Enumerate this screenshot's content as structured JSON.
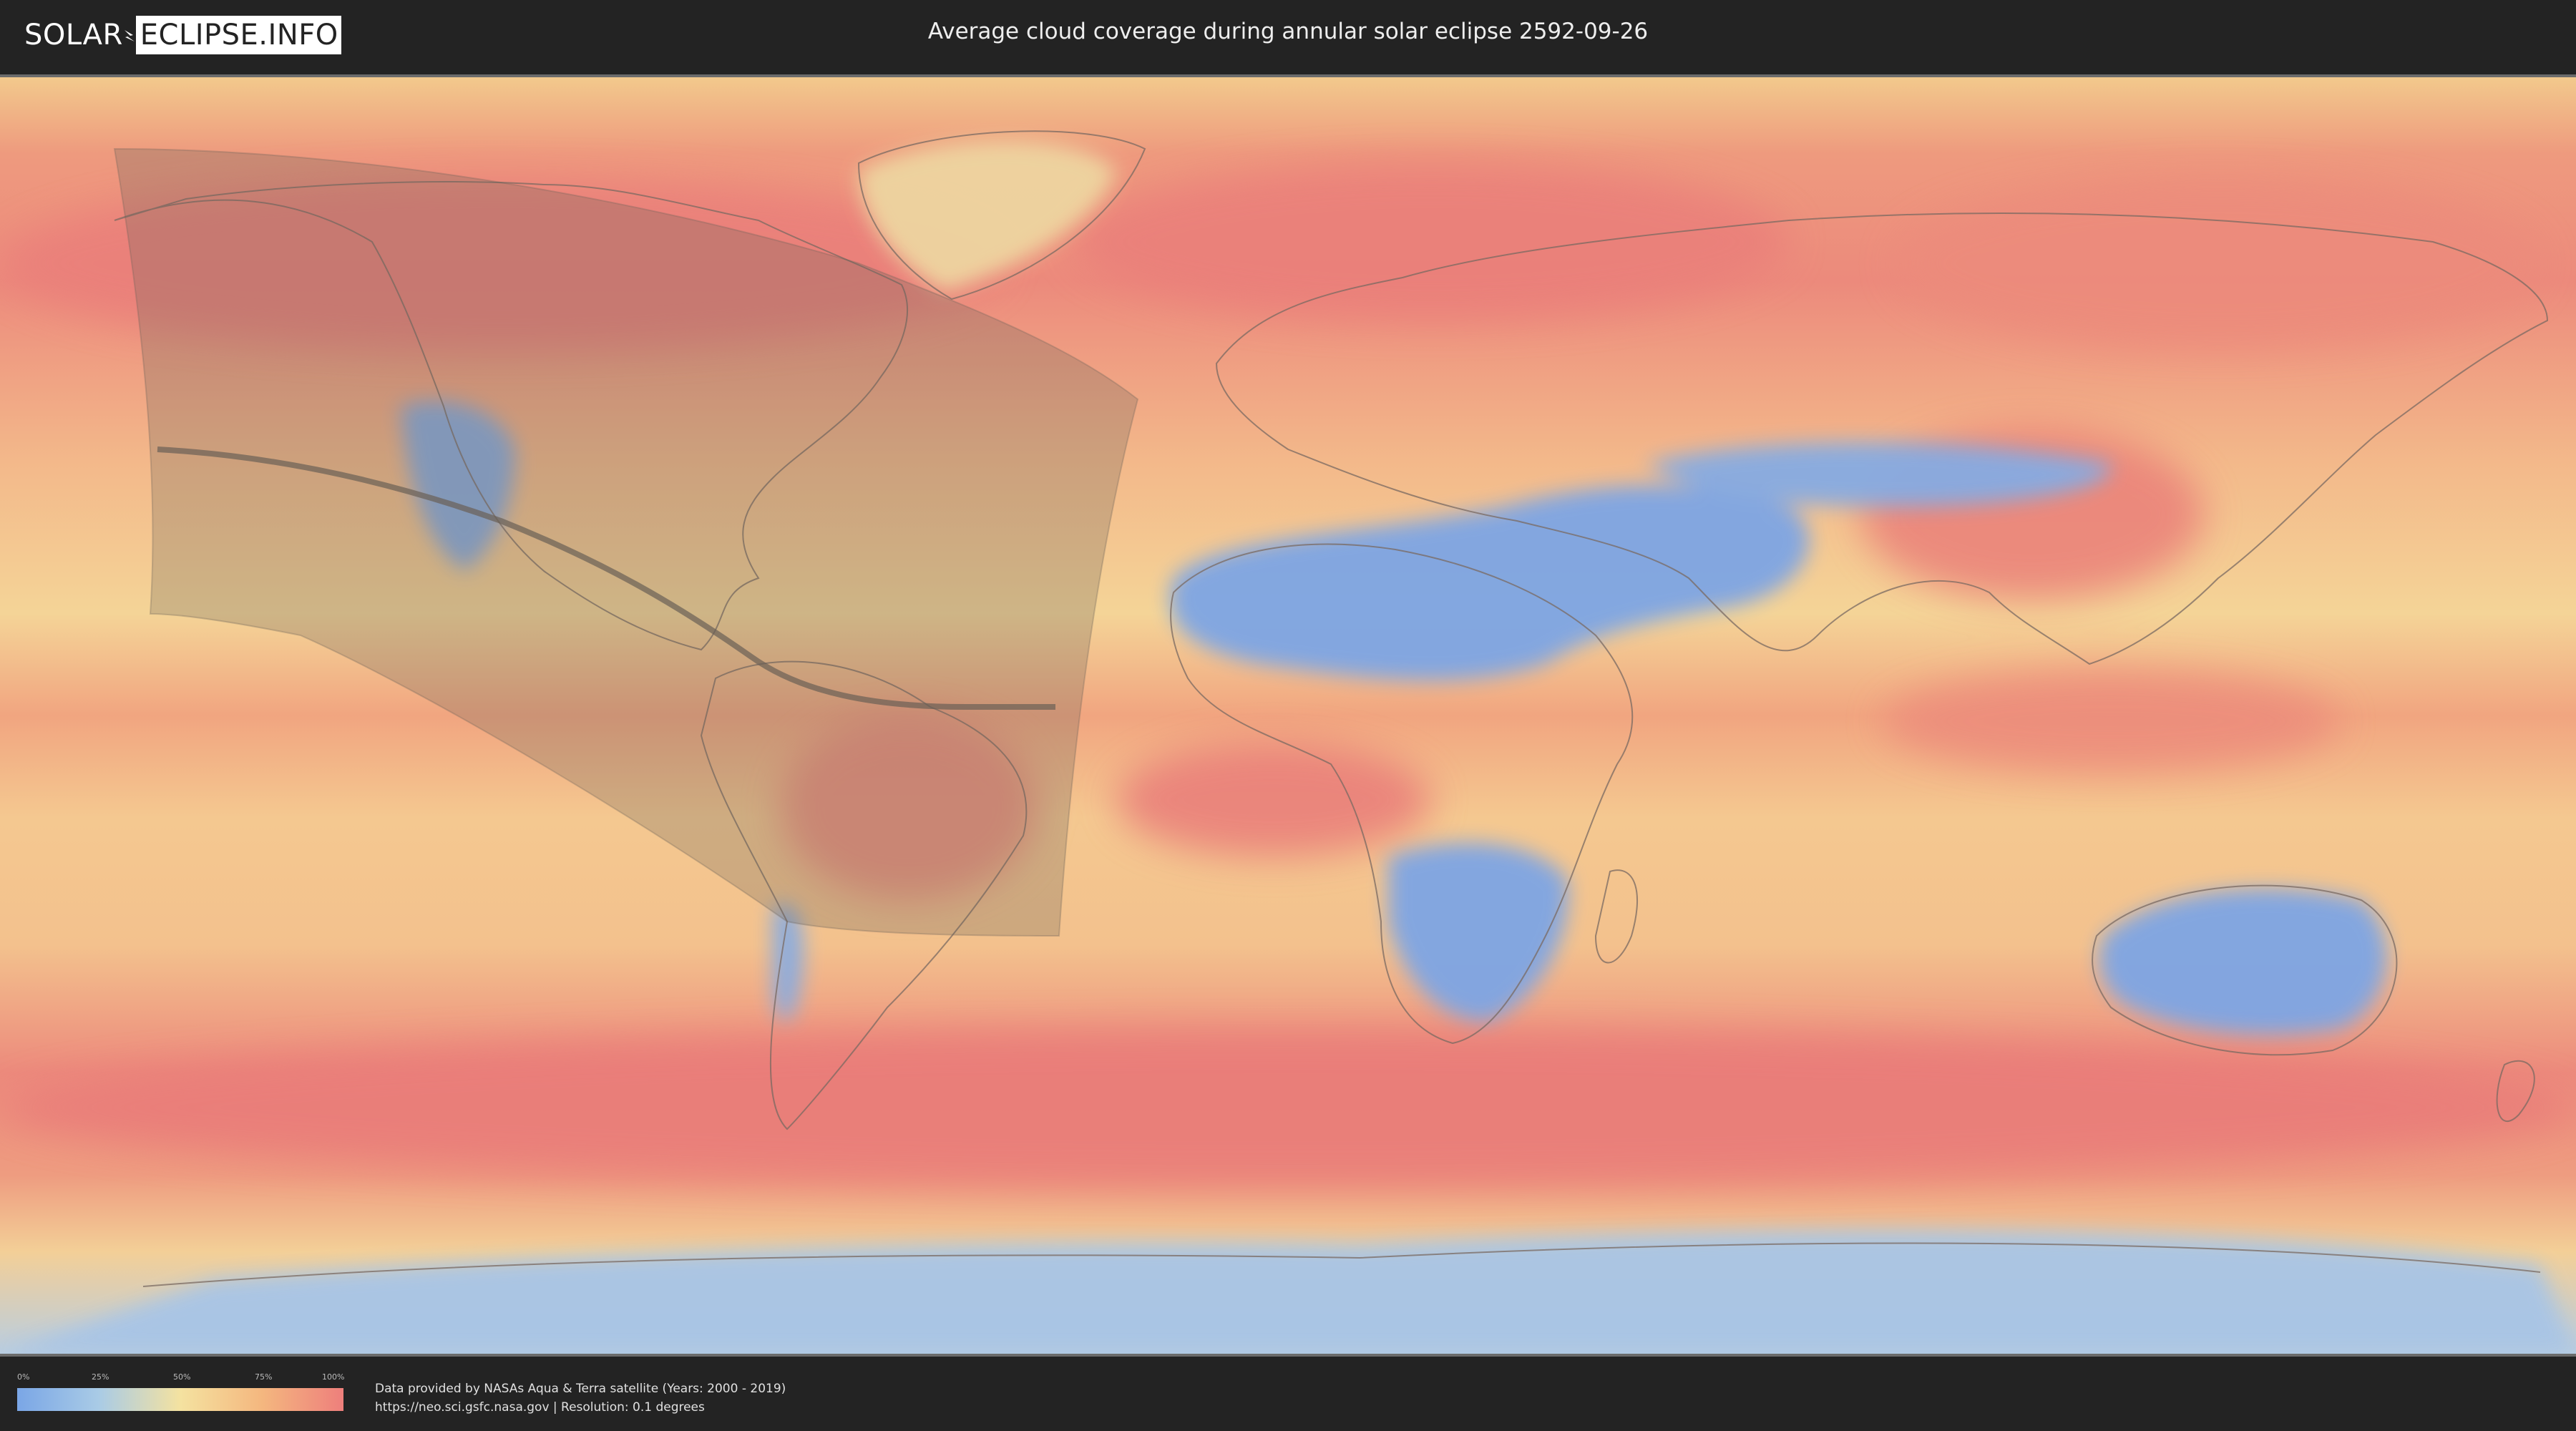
{
  "header": {
    "logo_left": "SOLAR",
    "logo_right": "ECLIPSE.INFO",
    "title": "Average cloud coverage during annular solar eclipse 2592-09-26"
  },
  "legend": {
    "ticks": [
      "0%",
      "25%",
      "50%",
      "75%",
      "100%"
    ],
    "colors": [
      "#7aa6e6",
      "#a9cbe6",
      "#f4e2a0",
      "#f4b77f",
      "#ee7f7c"
    ]
  },
  "credits": {
    "line1": "Data provided by NASAs Aqua & Terra satellite (Years: 2000 - 2019)",
    "line2": "https://neo.sci.gsfc.nasa.gov | Resolution: 0.1 degrees"
  },
  "map": {
    "projection": "equirectangular",
    "eclipse_type": "annular",
    "date": "2592-09-26",
    "colors": {
      "clear": "#7aa6e6",
      "partly": "#f4e2a0",
      "cloudy": "#ee7f7c",
      "eclipse_overlay": "#6d6558",
      "central_line": "#6a5f55"
    }
  }
}
